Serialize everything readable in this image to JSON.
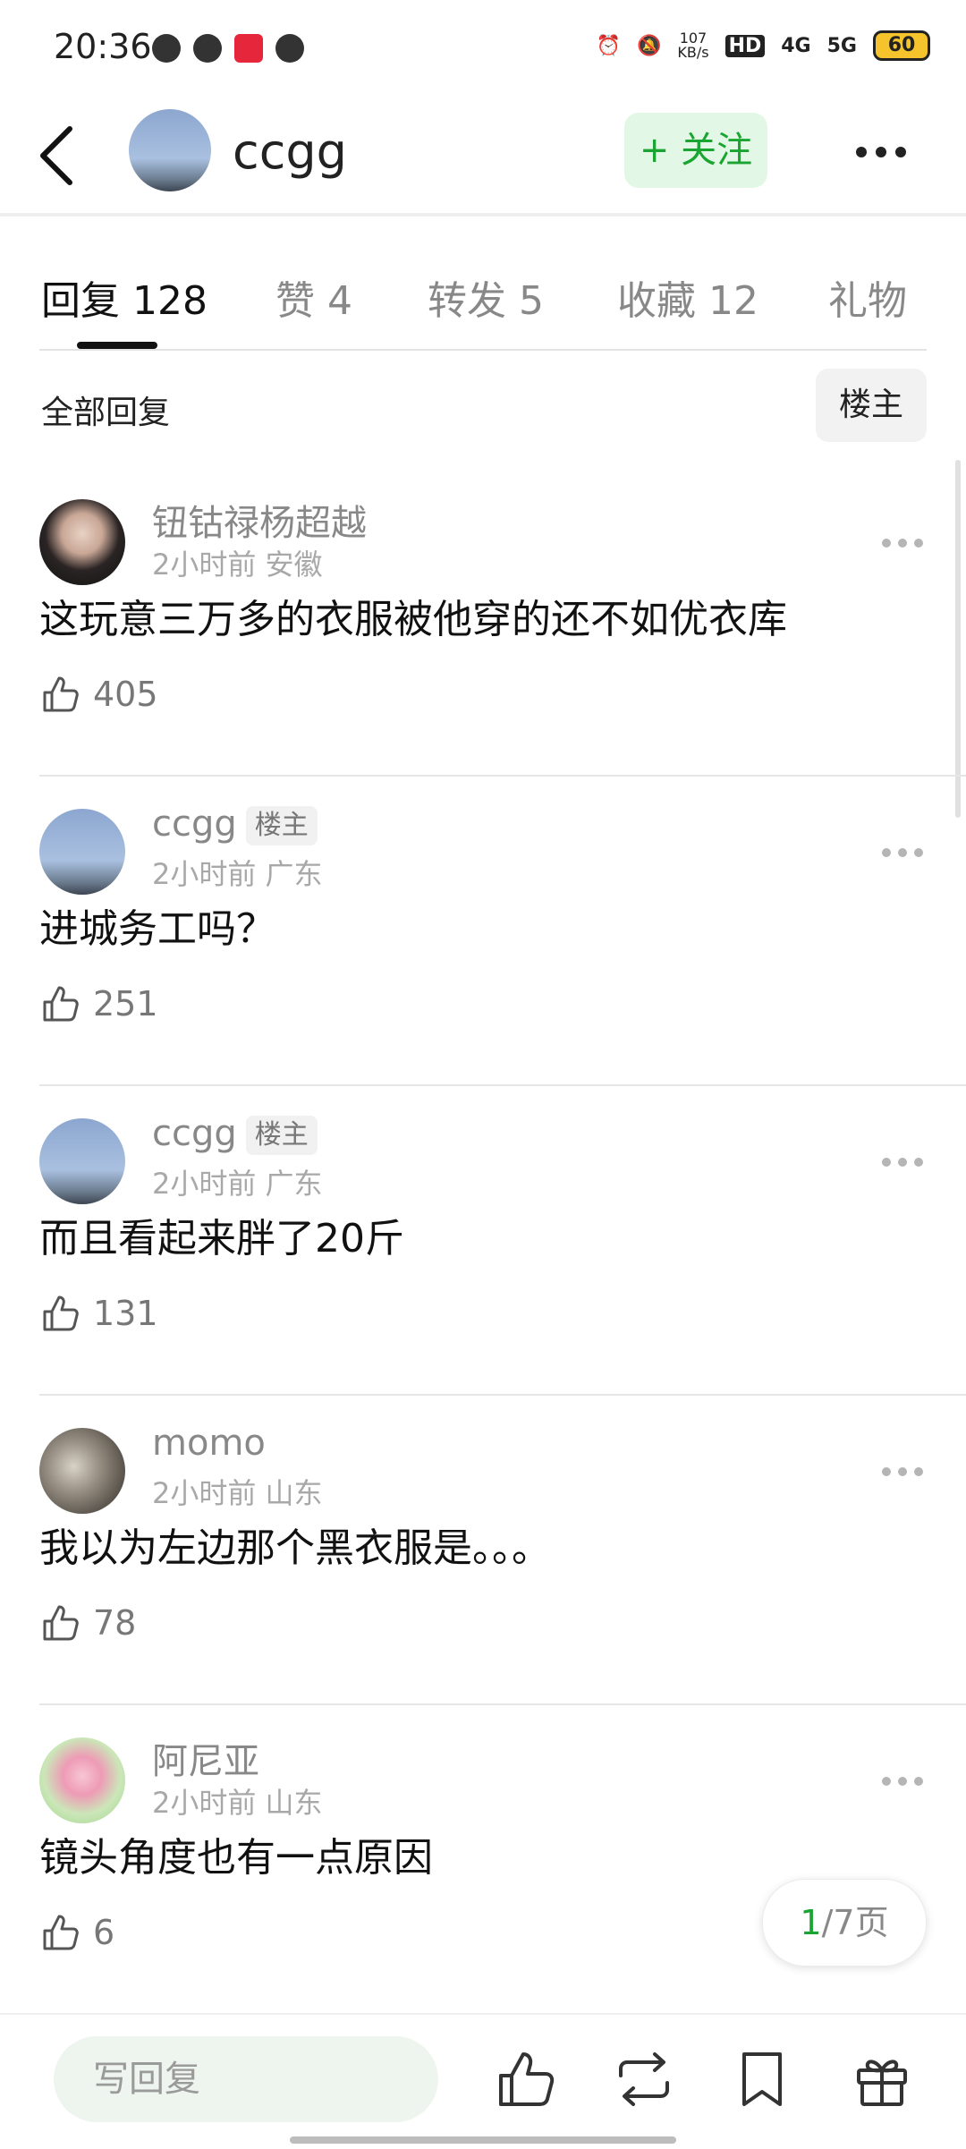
{
  "status_bar": {
    "time": "20:36",
    "net_speed": "107",
    "net_unit": "KB/s",
    "hd": "HD",
    "net1": "4G",
    "net2": "5G",
    "battery": "60",
    "app_badge": "小红书",
    "icons": [
      "weibo-icon",
      "chat-icon",
      "xiaohongshu-icon",
      "badge-icon",
      "alarm-icon",
      "mute-icon",
      "signal-icon"
    ]
  },
  "header": {
    "title": "ccgg",
    "follow_label": "+ 关注"
  },
  "tabs": [
    {
      "label": "回复 128",
      "active": true
    },
    {
      "label": "赞 4"
    },
    {
      "label": "转发 5"
    },
    {
      "label": "收藏 12"
    },
    {
      "label": "礼物"
    }
  ],
  "filter": {
    "label": "全部回复",
    "button": "楼主"
  },
  "comments": [
    {
      "name": "钮钴禄杨超越",
      "badge": "",
      "meta": "2小时前 安徽",
      "text": "这玩意三万多的衣服被他穿的还不如优衣库",
      "likes": "405"
    },
    {
      "name": "ccgg",
      "badge": "楼主",
      "meta": "2小时前 广东",
      "text": "进城务工吗？",
      "likes": "251"
    },
    {
      "name": "ccgg",
      "badge": "楼主",
      "meta": "2小时前 广东",
      "text": "而且看起来胖了20斤",
      "likes": "131"
    },
    {
      "name": "momo",
      "badge": "",
      "meta": "2小时前 山东",
      "text": "我以为左边那个黑衣服是。。。",
      "likes": "78"
    },
    {
      "name": "阿尼亚",
      "badge": "",
      "meta": "2小时前 山东",
      "text": "镜头角度也有一点原因",
      "likes": "6"
    }
  ],
  "pager": {
    "current": "1",
    "rest": "/7页"
  },
  "bottom_bar": {
    "reply_placeholder": "写回复"
  },
  "colors": {
    "accent_green": "#1aa532",
    "follow_bg": "#e3f7e6"
  }
}
